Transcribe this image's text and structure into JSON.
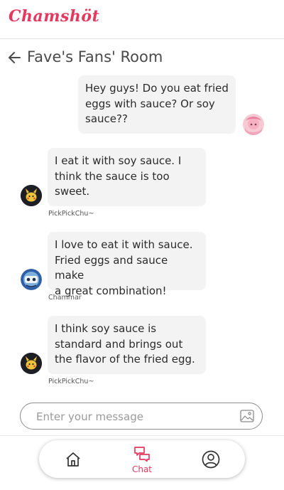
{
  "app": {
    "logo_text": "Chamshöt",
    "accent": "#e5385e"
  },
  "room": {
    "title": "Fave's Fans' Room"
  },
  "messages": [
    {
      "text": "Hey guys! Do you eat fried\neggs with sauce? Or soy\nsauce??",
      "own": true
    },
    {
      "text": "I eat it with soy sauce. I\nthink the sauce is too\nsweet.",
      "author": "PickPickChu~"
    },
    {
      "text": "I love to eat it with sauce.\nFried eggs and sauce make\na great combination!",
      "author": "Chammar"
    },
    {
      "text": "I think soy sauce is\nstandard and brings out\nthe flavor of the fried egg.",
      "author": "PickPickChu~"
    }
  ],
  "composer": {
    "placeholder": "Enter your message",
    "attach_icon": "image-icon"
  },
  "nav": {
    "items": [
      {
        "icon": "home-icon"
      },
      {
        "icon": "chat-icon",
        "label": "Chat",
        "active": true
      },
      {
        "icon": "profile-icon"
      }
    ]
  }
}
